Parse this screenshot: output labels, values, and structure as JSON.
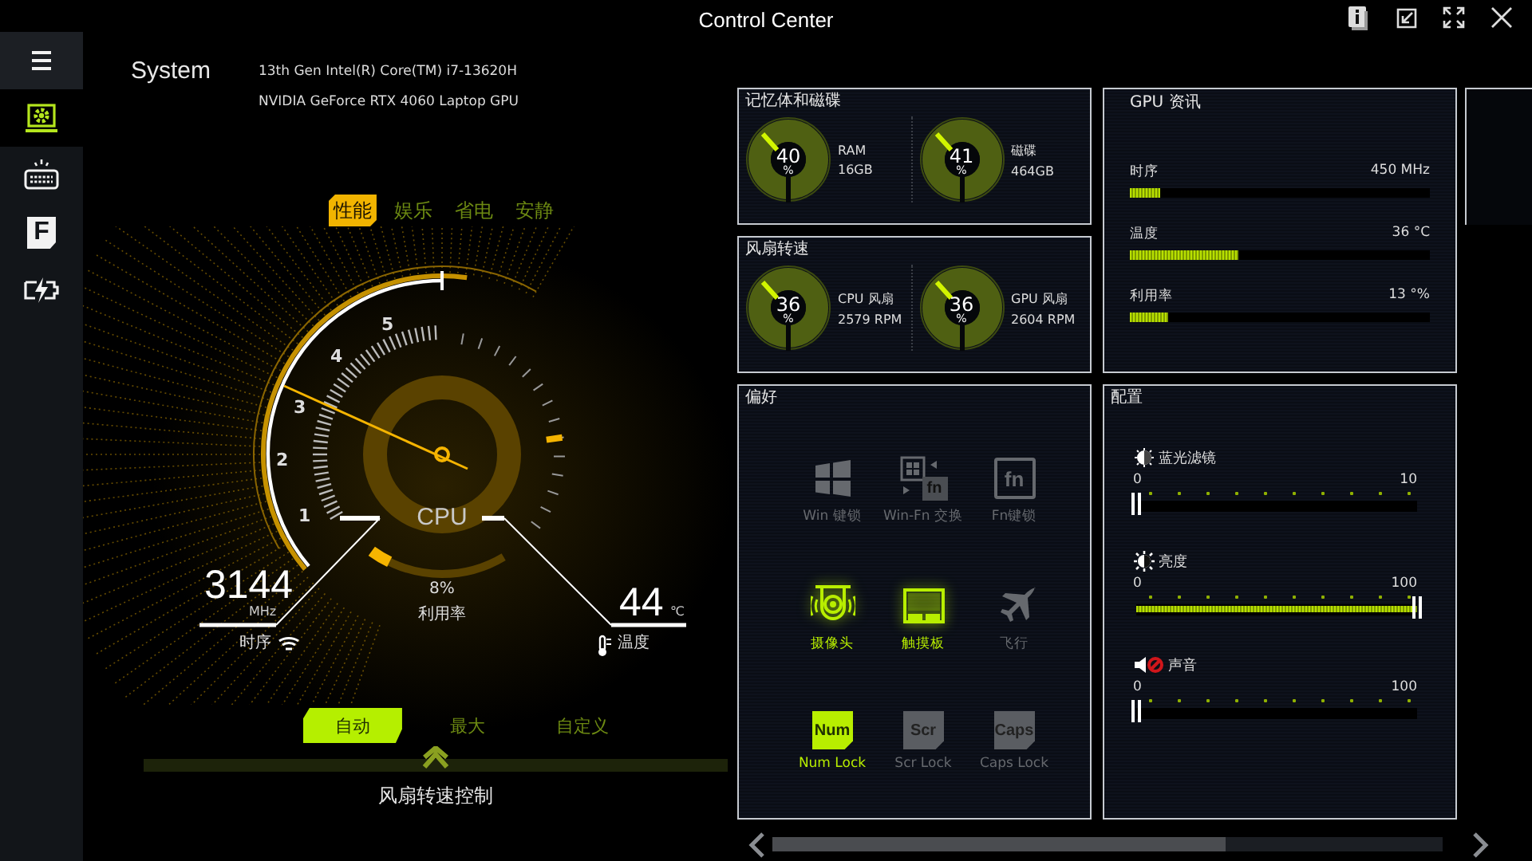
{
  "window": {
    "title": "Control Center",
    "buttons": [
      {
        "kind": "info"
      },
      {
        "kind": "restore"
      },
      {
        "kind": "fullscreen"
      },
      {
        "kind": "close"
      }
    ]
  },
  "sidebar": {
    "items": [
      {
        "kind": "menu",
        "selected": false
      },
      {
        "kind": "system",
        "selected": true
      },
      {
        "kind": "keyboard",
        "selected": false
      },
      {
        "kind": "function",
        "icon_text": "F",
        "selected": false
      },
      {
        "kind": "battery",
        "selected": false
      }
    ]
  },
  "system": {
    "title": "System",
    "cpu": "13th Gen Intel(R) Core(TM) i7-13620H",
    "gpu": "NVIDIA GeForce RTX 4060 Laptop GPU"
  },
  "modes": [
    {
      "label": "性能",
      "selected": true
    },
    {
      "label": "娱乐",
      "selected": false
    },
    {
      "label": "省电",
      "selected": false
    },
    {
      "label": "安静",
      "selected": false
    }
  ],
  "gauge": {
    "scale": [
      "1",
      "2",
      "3",
      "4",
      "5"
    ],
    "label": "CPU",
    "clock": "3144",
    "clock_unit": "MHz",
    "clock_label": "时序",
    "usage": "8%",
    "usage_label": "利用率",
    "temperature": "44",
    "temperature_unit": "℃",
    "temperature_label": "温度"
  },
  "fan_modes": [
    {
      "label": "自动",
      "selected": true
    },
    {
      "label": "最大",
      "selected": false
    },
    {
      "label": "自定义",
      "selected": false
    }
  ],
  "fan_control": {
    "label": "风扇转速控制"
  },
  "memory_panel": {
    "title": "记忆体和磁碟",
    "items": [
      {
        "value": "40",
        "unit": "%",
        "name": "RAM",
        "detail": "16GB"
      },
      {
        "value": "41",
        "unit": "%",
        "name": "磁碟",
        "detail": "464GB"
      }
    ]
  },
  "fan_panel": {
    "title": "风扇转速",
    "items": [
      {
        "value": "36",
        "unit": "%",
        "name": "CPU 风扇",
        "detail": "2579 RPM"
      },
      {
        "value": "36",
        "unit": "%",
        "name": "GPU 风扇",
        "detail": "2604 RPM"
      }
    ]
  },
  "gpu_panel": {
    "title": "GPU 资讯",
    "rows": [
      {
        "label": "时序",
        "reading": "450 MHz",
        "level": 0.1
      },
      {
        "label": "温度",
        "reading": "36 °C",
        "level": 0.36
      },
      {
        "label": "利用率",
        "reading": "13 °%",
        "level": 0.13
      }
    ]
  },
  "preferences": {
    "title": "偏好",
    "items": [
      {
        "kind": "windows",
        "label": "Win 键锁",
        "on": false
      },
      {
        "kind": "win-fn",
        "icon_text": "fn",
        "label": "Win-Fn 交换",
        "on": false
      },
      {
        "kind": "fn",
        "icon_text": "fn",
        "label": "Fn键锁",
        "on": false
      },
      {
        "kind": "camera",
        "label": "摄像头",
        "on": true
      },
      {
        "kind": "touchpad",
        "label": "触摸板",
        "on": true
      },
      {
        "kind": "airplane",
        "label": "飞行",
        "on": false
      },
      {
        "kind": "key",
        "icon_text": "Num",
        "label": "Num Lock",
        "on": true
      },
      {
        "kind": "key",
        "icon_text": "Scr",
        "label": "Scr Lock",
        "on": false
      },
      {
        "kind": "key",
        "icon_text": "Caps",
        "label": "Caps Lock",
        "on": false
      }
    ]
  },
  "settings": {
    "title": "配置",
    "sliders": [
      {
        "kind": "blue-light",
        "label": "蓝光滤镜",
        "min": "0",
        "max": "10",
        "level": 0
      },
      {
        "kind": "brightness",
        "label": "亮度",
        "min": "0",
        "max": "100",
        "level": 1
      },
      {
        "kind": "sound",
        "label": "声音",
        "min": "0",
        "max": "100",
        "level": 0,
        "muted": true
      }
    ]
  }
}
